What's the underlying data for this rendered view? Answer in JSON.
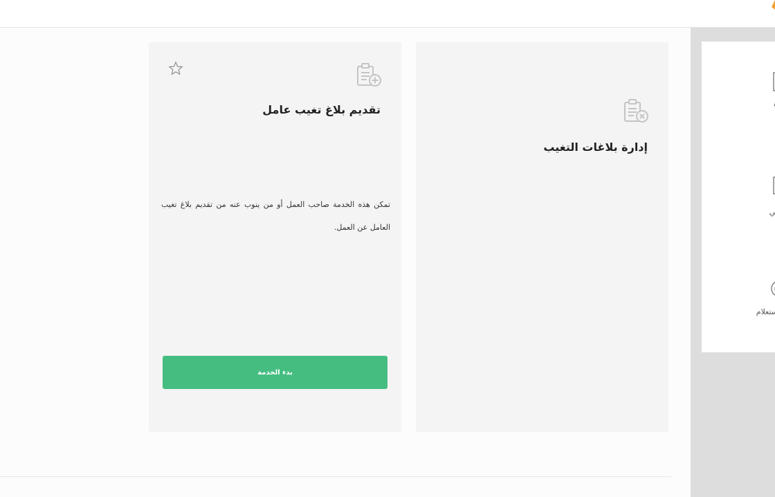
{
  "header": {
    "logo_icon": "brand-logo-icon",
    "accent_color": "#f0a030"
  },
  "sidebar": {
    "items": [
      {
        "label": "ة",
        "icon": "document-icon"
      },
      {
        "label": "تي",
        "icon": "calendar-icon"
      },
      {
        "label": "ستعلام",
        "icon": "search-fingerprint-icon"
      }
    ]
  },
  "cards": [
    {
      "title": "تقديم بلاغ تغيب عامل",
      "description": "تمكن هذه الخدمة صاحب العمل أو من ينوب عنه من تقديم بلاغ تغيب العامل عن العمل.",
      "button_label": "بدء الخدمة",
      "icon": "clipboard-add-icon",
      "favorite_icon": "star-outline-icon"
    },
    {
      "title": "إدارة بلاغات التغيب",
      "icon": "clipboard-remove-icon"
    }
  ],
  "colors": {
    "primary_button": "#45bd81",
    "card_background": "#f4f4f4",
    "sidebar_background": "#dddddd"
  }
}
